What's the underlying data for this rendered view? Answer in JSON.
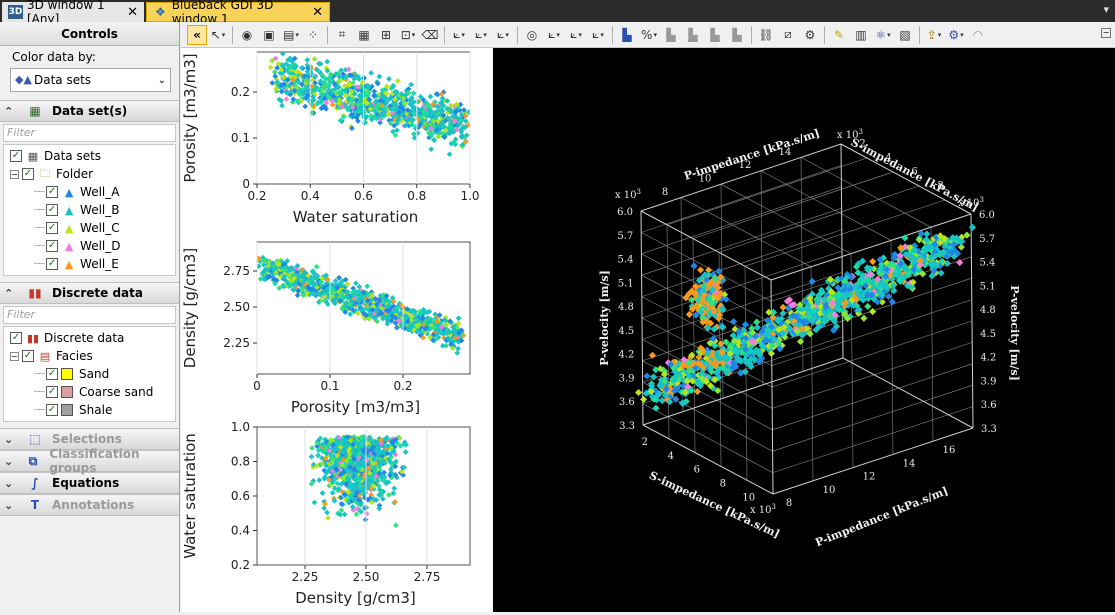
{
  "tabs": [
    {
      "label": "3D window 1 [Any]",
      "icon": "3d-window-icon"
    },
    {
      "label": "Blueback GDI 3D window 1",
      "icon": "blueback-icon"
    }
  ],
  "sidebar": {
    "title": "Controls",
    "color_by_label": "Color data by:",
    "color_by_value": "Data sets",
    "datasets_section": {
      "title": "Data set(s)",
      "filter_placeholder": "Filter",
      "root": "Data sets",
      "folder": "Folder",
      "wells": [
        {
          "label": "Well_A",
          "color": "#1f88e5"
        },
        {
          "label": "Well_B",
          "color": "#18c4c4"
        },
        {
          "label": "Well_C",
          "color": "#b8e61a"
        },
        {
          "label": "Well_D",
          "color": "#f27de0"
        },
        {
          "label": "Well_E",
          "color": "#f59a1e"
        }
      ]
    },
    "discrete_section": {
      "title": "Discrete data",
      "filter_placeholder": "Filter",
      "root": "Discrete data",
      "facies": "Facies",
      "items": [
        {
          "label": "Sand",
          "color": "#ffff00"
        },
        {
          "label": "Coarse sand",
          "color": "#d8a0a0"
        },
        {
          "label": "Shale",
          "color": "#a0a0a0"
        }
      ]
    },
    "collapsed_sections": [
      {
        "label": "Selections",
        "enabled": false
      },
      {
        "label": "Classification groups",
        "enabled": false
      },
      {
        "label": "Equations",
        "enabled": true
      },
      {
        "label": "Annotations",
        "enabled": false
      }
    ]
  },
  "plots": [
    {
      "xlabel": "Water saturation",
      "ylabel": "Porosity [m3/m3]",
      "xticks": [
        "0.2",
        "0.4",
        "0.6",
        "0.8",
        "1.0"
      ],
      "yticks": [
        "0",
        "0.1",
        "0.2"
      ]
    },
    {
      "xlabel": "Porosity [m3/m3]",
      "ylabel": "Density [g/cm3]",
      "xticks": [
        "0",
        "0.1",
        "0.2"
      ],
      "yticks": [
        "2.25",
        "2.50",
        "2.75"
      ]
    },
    {
      "xlabel": "Density [g/cm3]",
      "ylabel": "Water saturation",
      "xticks": [
        "2.25",
        "2.50",
        "2.75"
      ],
      "yticks": [
        "0.2",
        "0.4",
        "0.6",
        "0.8",
        "1.0"
      ]
    }
  ],
  "view3d": {
    "axis_p_impedance": "P-impedance [kPa.s/m]",
    "axis_s_impedance": "S-impedance [kPa.s/m]",
    "axis_p_velocity": "P-velocity [m/s]",
    "axis_exp": "x 10",
    "exp_sup": "3",
    "p_velocity_ticks": [
      "3.3",
      "3.6",
      "3.9",
      "4.2",
      "4.5",
      "4.8",
      "5.1",
      "5.4",
      "5.7",
      "6.0"
    ],
    "p_impedance_ticks_bottom": [
      "8",
      "10",
      "12",
      "14",
      "16"
    ],
    "s_impedance_ticks_bottom": [
      "2",
      "4",
      "6",
      "8",
      "10"
    ],
    "p_impedance_ticks_top": [
      "8",
      "10",
      "12",
      "14"
    ],
    "s_impedance_ticks_top": [
      "2",
      "4",
      "6",
      "8"
    ]
  }
}
